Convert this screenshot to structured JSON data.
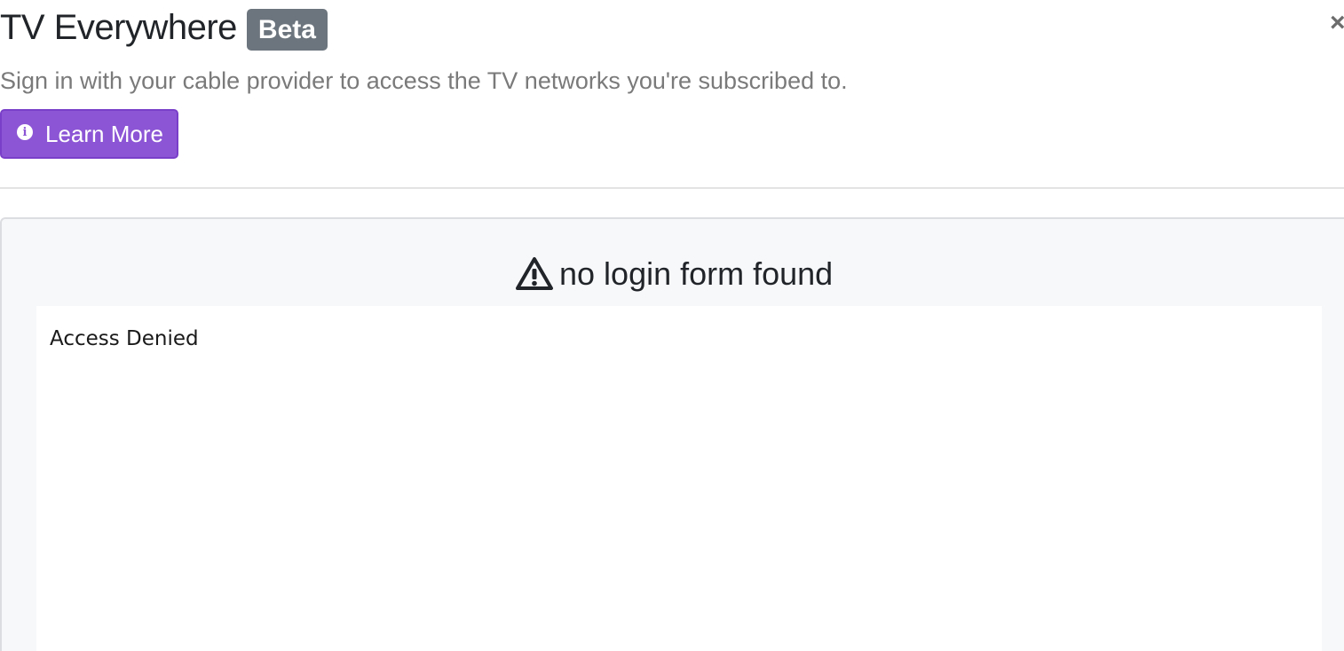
{
  "header": {
    "title": "TV Everywhere",
    "badge": "Beta",
    "close_icon": "close-icon"
  },
  "intro": {
    "subtitle": "Sign in with your cable provider to access the TV networks you're subscribed to.",
    "learn_more_label": "Learn More",
    "learn_more_icon": "info-circle-icon"
  },
  "panel": {
    "heading_icon": "warning-triangle-icon",
    "heading": "no login form found",
    "frame_text": "Access Denied"
  },
  "colors": {
    "accent": "#8c55d6",
    "badge": "#6c757d",
    "panel_bg": "#f7f8fa"
  }
}
